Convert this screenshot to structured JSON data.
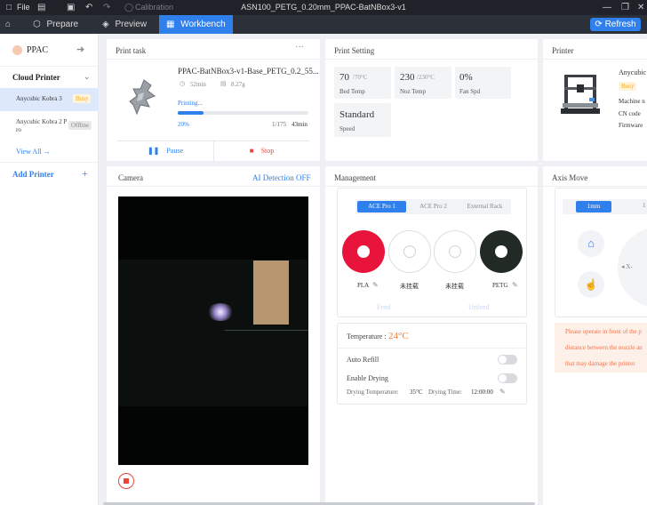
{
  "titlebar": {
    "file_label": "File",
    "calibration_label": "Calibration",
    "window_title": "ASN100_PETG_0.20mm_PPAC-BatNBox3-v1"
  },
  "nav": {
    "prepare_label": "Prepare",
    "preview_label": "Preview",
    "workbench_label": "Workbench",
    "refresh_label": "Refresh"
  },
  "sidebar": {
    "user_name": "PPAC",
    "cloud_printer_label": "Cloud Printer",
    "printers": [
      {
        "name": "Anycubic Kobra 3",
        "status": "Busy"
      },
      {
        "name": "Anycubic Kobra 2 Pro",
        "name_line1": "Anycubic Kobra 2 P",
        "name_line2": "ro",
        "status": "Offline"
      }
    ],
    "view_all_label": "View All",
    "add_printer_label": "Add Printer"
  },
  "print_task": {
    "title": "Print task",
    "file_name": "PPAC-BatNBox3-v1-Base_PETG_0.2_55...",
    "duration": "52min",
    "weight": "8.27g",
    "status": "Printing...",
    "progress_percent": 20,
    "progress_label": "20%",
    "layers": "1/175",
    "remaining": "43min",
    "pause_label": "Pause",
    "stop_label": "Stop"
  },
  "print_setting": {
    "title": "Print Setting",
    "bed_temp": "70",
    "bed_temp_target": "/70°C",
    "bed_temp_label": "Bed Temp",
    "noz_temp": "230",
    "noz_temp_target": "/230°C",
    "noz_temp_label": "Noz Temp",
    "fan_speed": "0%",
    "fan_speed_label": "Fan Spd",
    "speed_mode": "Standard",
    "speed_label": "Speed"
  },
  "printer": {
    "title": "Printer",
    "model": "Anycubic",
    "status": "Busy",
    "machine_label": "Machine n",
    "cn_code_label": "CN code",
    "firmware_label": "Firmware"
  },
  "camera": {
    "title": "Camera",
    "ai_detection_label": "AI Detection OFF"
  },
  "management": {
    "title": "Management",
    "tabs": [
      "ACE Pro 1",
      "ACE Pro 2",
      "External Rack"
    ],
    "slots": [
      {
        "label": "PLA",
        "color": "#e8143c"
      },
      {
        "label": "未挂载",
        "color": "#ffffff"
      },
      {
        "label": "未挂载",
        "color": "#ffffff"
      },
      {
        "label": "PETG",
        "color": "#222a26"
      }
    ],
    "feed_label": "Feed",
    "unfeed_label": "Unfeed",
    "temperature_label": "Temperature :",
    "temperature_value": "24°C",
    "auto_refill_label": "Auto Refill",
    "enable_drying_label": "Enable Drying",
    "drying_temp_label": "Drying Temperature:",
    "drying_temp_value": "35°C",
    "drying_time_label": "Drying Time:",
    "drying_time_value": "12:00:00"
  },
  "axis_move": {
    "title": "Axis Move",
    "step_active": "1mm",
    "step_next": "1",
    "x_minus_label": "X-",
    "warning_line1": "Please operate in front of the p",
    "warning_line2": "distance between the nozzle an",
    "warning_line3": "that may damage the printer"
  },
  "colors": {
    "accent": "#2f80ed",
    "busy_badge": "#f5a623",
    "warning_text": "#f0734a",
    "temp_value": "#f0803c"
  }
}
